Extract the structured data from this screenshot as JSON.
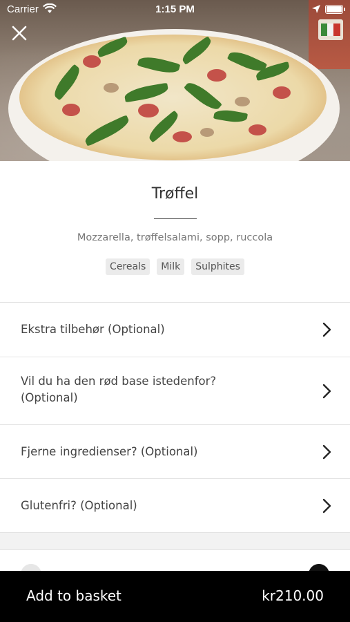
{
  "status_bar": {
    "carrier": "Carrier",
    "time": "1:15 PM"
  },
  "hero": {
    "image": "pizza-photo"
  },
  "product": {
    "title": "Trøffel",
    "description": "Mozzarella, trøffelsalami, sopp, ruccola",
    "allergens": [
      "Cereals",
      "Milk",
      "Sulphites"
    ]
  },
  "options": [
    {
      "label": "Ekstra tilbehør (Optional)",
      "icon": "chevron-right-icon"
    },
    {
      "label": "Vil du ha den rød base istedenfor? (Optional)",
      "icon": "chevron-right-icon"
    },
    {
      "label": "Fjerne ingredienser? (Optional)",
      "icon": "chevron-right-icon"
    },
    {
      "label": "Glutenfri? (Optional)",
      "icon": "chevron-right-icon"
    }
  ],
  "footer": {
    "add_label": "Add to basket",
    "price": "kr210.00"
  },
  "colors": {
    "bottom_bar": "#000000",
    "tag_bg": "#ebebeb",
    "divider": "#e3e3e3"
  }
}
